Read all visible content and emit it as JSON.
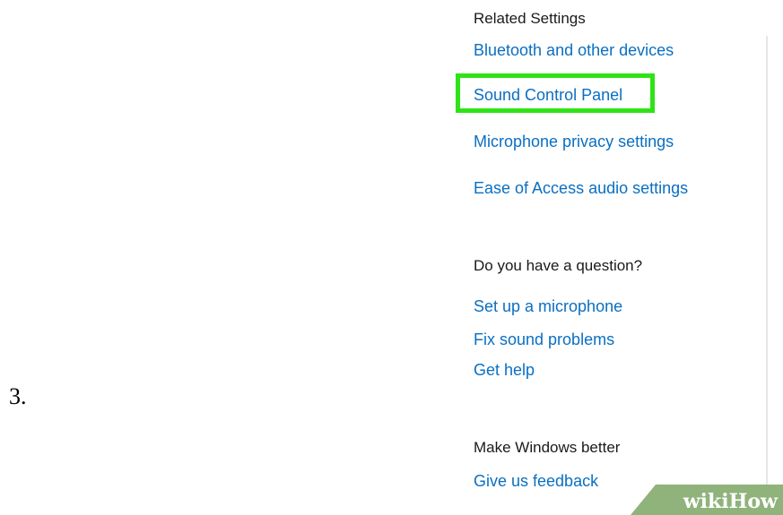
{
  "step_number": "3.",
  "related_settings": {
    "heading": "Related Settings",
    "links": [
      "Bluetooth and other devices",
      "Sound Control Panel",
      "Microphone privacy settings",
      "Ease of Access audio settings"
    ]
  },
  "question_section": {
    "heading": "Do you have a question?",
    "links": [
      "Set up a microphone",
      "Fix sound problems",
      "Get help"
    ]
  },
  "feedback_section": {
    "heading": "Make Windows better",
    "links": [
      "Give us feedback"
    ]
  },
  "highlighted_item": "Sound Control Panel",
  "watermark": {
    "part1": "wiki",
    "part2": "How"
  },
  "colors": {
    "link": "#0a6fc2",
    "heading": "#1a1a1a",
    "highlight": "#2ee316",
    "watermark_band": "#8fb37b"
  }
}
